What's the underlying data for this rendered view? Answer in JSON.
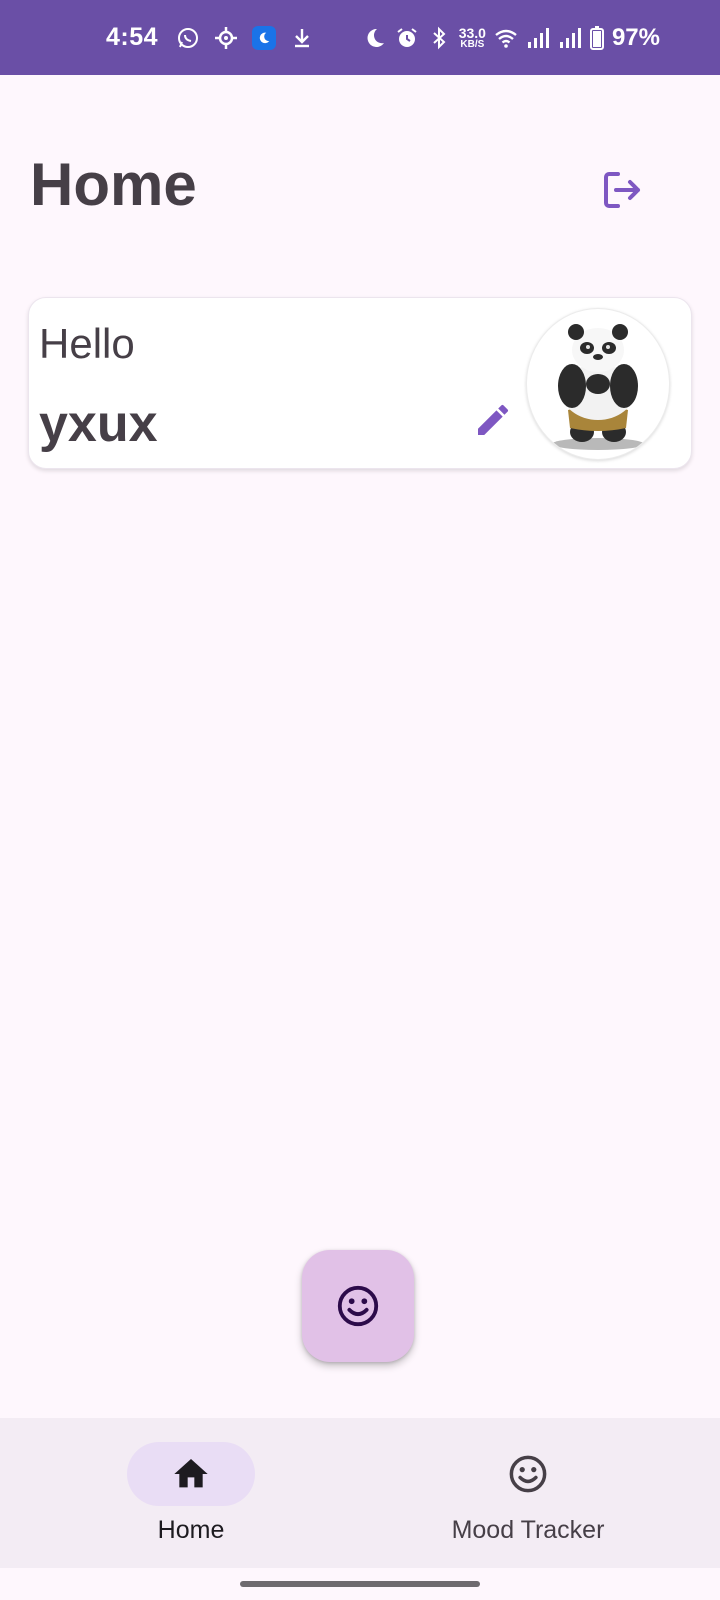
{
  "status_bar": {
    "time": "4:54",
    "network_speed_value": "33.0",
    "network_speed_unit": "KB/S",
    "battery_percent": "97%",
    "background_color": "#6a4fa6"
  },
  "header": {
    "title": "Home",
    "logout_icon": "logout-icon"
  },
  "greeting_card": {
    "hello": "Hello",
    "username": "yxux",
    "edit_icon": "pencil-icon",
    "avatar": "panda-avatar"
  },
  "fab": {
    "icon": "smiley-icon",
    "color": "#e1c1e7"
  },
  "bottom_nav": {
    "items": [
      {
        "label": "Home",
        "icon": "home-icon",
        "selected": true
      },
      {
        "label": "Mood Tracker",
        "icon": "smiley-icon",
        "selected": false
      }
    ]
  },
  "colors": {
    "accent": "#7e57c2",
    "background": "#fef7fd",
    "text": "#463f47"
  }
}
